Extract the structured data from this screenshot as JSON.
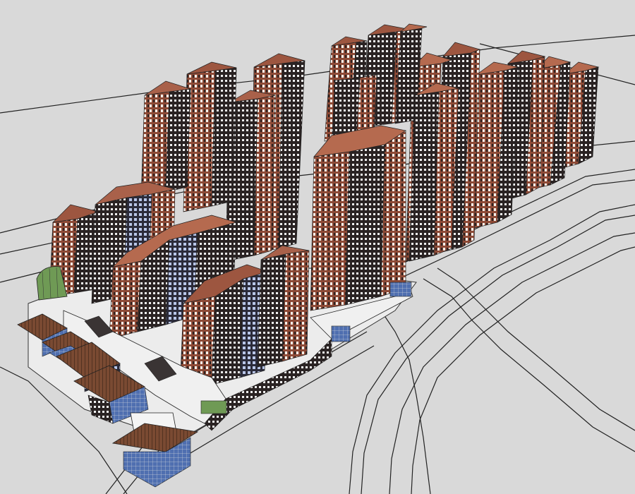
{
  "model": {
    "tower_count": 21,
    "podium_count": 6,
    "palette": {
      "ground": "#d9d9d9",
      "site": "#e8e8e8",
      "road_line": "#222222",
      "facade_brick": "#8e4a36",
      "facade_brick_light": "#a86550",
      "facade_dark": "#2a2323",
      "window_white": "#f4f4f4",
      "window_blue": "#b9c6e8",
      "glass_green": "#6f9a55",
      "glass_blue": "#4f6fb0",
      "roof_wood": "#7a4a32"
    }
  }
}
